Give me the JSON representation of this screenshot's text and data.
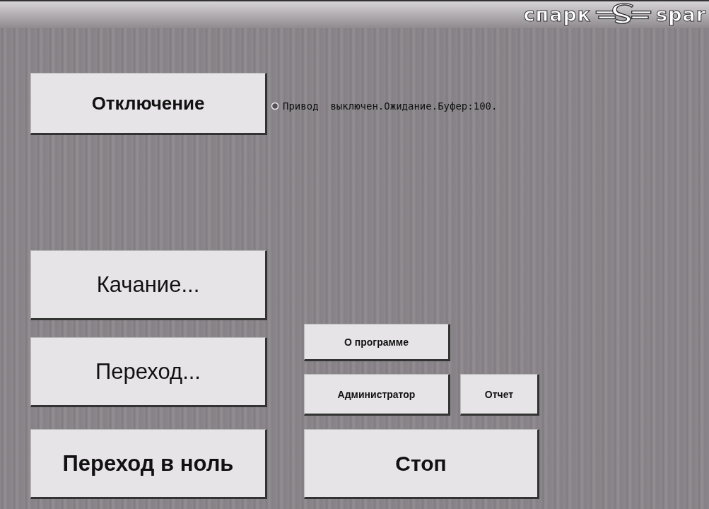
{
  "header": {
    "logo_left": "спарк",
    "logo_right": "spar"
  },
  "status": {
    "text": "Привод  выключен.Ожидание.Буфер:100."
  },
  "left_buttons": [
    {
      "label": "Отключение"
    },
    {
      "label": "Качание..."
    },
    {
      "label": "Переход..."
    },
    {
      "label": "Переход в ноль"
    }
  ],
  "right_buttons": {
    "about": "О программе",
    "admin": "Администратор",
    "report": "Отчет",
    "stop": "Стоп"
  }
}
